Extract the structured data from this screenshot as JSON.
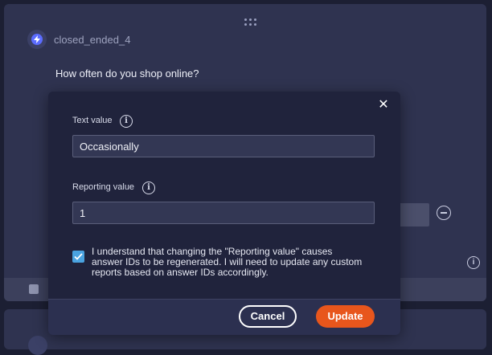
{
  "question": {
    "id": "closed_ended_4",
    "text": "How often do you shop online?",
    "icon": "lightning-bolt-icon"
  },
  "modal": {
    "close_icon": "close-icon",
    "text_value_label": "Text value",
    "text_value": "Occasionally",
    "reporting_value_label": "Reporting value",
    "reporting_value": "1",
    "disclaimer": "I understand that changing the \"Reporting value\" causes answer IDs to be regenerated. I will need to update any custom reports based on answer IDs accordingly.",
    "checkbox_checked": true,
    "cancel_label": "Cancel",
    "update_label": "Update"
  },
  "colors": {
    "accent": "#e8561c",
    "checkbox": "#4aa3e0",
    "brand": "#5b6cff"
  }
}
